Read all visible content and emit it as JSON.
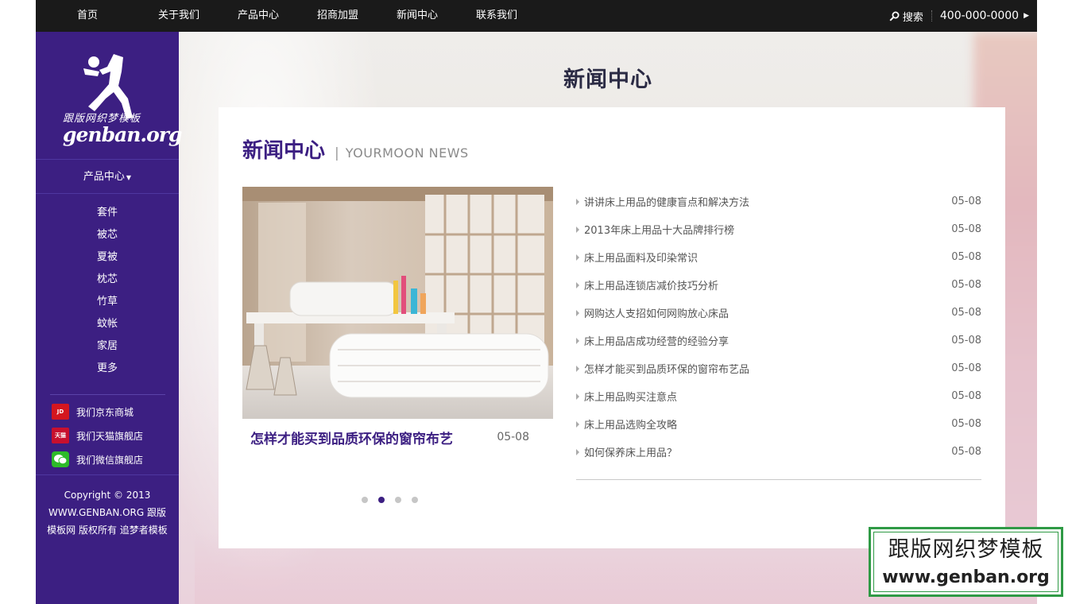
{
  "nav": {
    "items": [
      "首页",
      "关于我们",
      "产品中心",
      "招商加盟",
      "新闻中心",
      "联系我们"
    ],
    "search_label": "搜索",
    "phone": "400-000-0000"
  },
  "sidebar": {
    "logo_cn": "跟版网织梦模板",
    "logo_en": "genban.org",
    "heading": "产品中心",
    "categories": [
      "套件",
      "被芯",
      "夏被",
      "枕芯",
      "竹草",
      "蚊帐",
      "家居",
      "更多"
    ],
    "shops": [
      {
        "label": "我们京东商城",
        "icon": "jd-icon",
        "badge": "JD"
      },
      {
        "label": "我们天猫旗舰店",
        "icon": "tmall-icon",
        "badge": "天猫"
      },
      {
        "label": "我们微信旗舰店",
        "icon": "wechat-icon",
        "badge": ""
      }
    ],
    "copyright": "Copyright © 2013 WWW.GENBAN.ORG 跟版模板网 版权所有 追梦者模板"
  },
  "main": {
    "page_heading": "新闻中心",
    "section_title_cn": "新闻中心",
    "section_title_sep": "|",
    "section_title_en": "YOURMOON NEWS",
    "featured": {
      "title": "怎样才能买到品质环保的窗帘布艺",
      "date": "05-08",
      "slide_count": 4,
      "active_slide": 2
    },
    "news": [
      {
        "title": "讲讲床上用品的健康盲点和解决方法",
        "date": "05-08"
      },
      {
        "title": "2013年床上用品十大品牌排行榜",
        "date": "05-08"
      },
      {
        "title": "床上用品面料及印染常识",
        "date": "05-08"
      },
      {
        "title": "床上用品连锁店减价技巧分析",
        "date": "05-08"
      },
      {
        "title": "网购达人支招如何网购放心床品",
        "date": "05-08"
      },
      {
        "title": "床上用品店成功经营的经验分享",
        "date": "05-08"
      },
      {
        "title": "怎样才能买到品质环保的窗帘布艺品",
        "date": "05-08"
      },
      {
        "title": "床上用品购买注意点",
        "date": "05-08"
      },
      {
        "title": "床上用品选购全攻略",
        "date": "05-08"
      },
      {
        "title": "如何保养床上用品？",
        "date": "05-08"
      }
    ]
  },
  "watermark": {
    "cn": "跟版网织梦模板",
    "en": "www.genban.org"
  },
  "colors": {
    "sidebar_bg": "#3c1f82",
    "topbar_bg": "#1a1a1a",
    "accent": "#3c1f82",
    "watermark_border": "#2f9a45"
  }
}
